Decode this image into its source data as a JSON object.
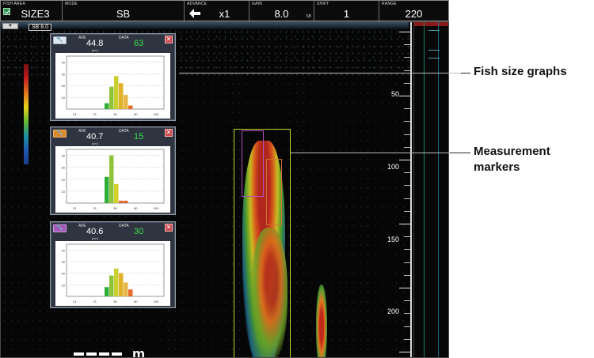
{
  "toolbar": {
    "fish_area": {
      "caption": "FISH AREA",
      "value": "SIZE3",
      "checked": true
    },
    "mode": {
      "caption": "MODE",
      "value": "SB"
    },
    "advance": {
      "caption": "ADVANCE",
      "value": "x1",
      "icon": "arrow-left-icon"
    },
    "gain": {
      "caption": "GAIN",
      "value": "8.0",
      "unit": "SB"
    },
    "shift": {
      "caption": "SHIFT",
      "value": "1"
    },
    "range": {
      "caption": "RANGE",
      "value": "220"
    }
  },
  "echo": {
    "dropdown_icon": "triangle-down-icon",
    "sb_box": "SB 8.0",
    "depth_labels": [
      "50",
      "100",
      "150",
      "200"
    ],
    "scale_unit": "m"
  },
  "panels": [
    {
      "tool_icon": "wrench-icon",
      "ave_caption": "AVE",
      "data_caption": "DATA",
      "ave": "44.8",
      "unit": "[cm]",
      "data": "63",
      "chart_data": {
        "type": "bar",
        "x_ticks": [
          "13",
          "21",
          "36",
          "60",
          "100"
        ],
        "y_ticks": [
          "40",
          "30",
          "20",
          "10"
        ],
        "ylim": [
          0,
          45
        ],
        "values": [
          5,
          19,
          28,
          22,
          12,
          3
        ],
        "colors": [
          "#2fae3a",
          "#8fc43a",
          "#c9cf2c",
          "#e2b12a",
          "#e9b74a",
          "#e86b2a"
        ]
      }
    },
    {
      "tool_icon": "wrench-icon",
      "ave_caption": "AVE",
      "data_caption": "DATA",
      "ave": "40.7",
      "unit": "[cm]",
      "data": "15",
      "chart_data": {
        "type": "bar",
        "x_ticks": [
          "13",
          "21",
          "36",
          "60",
          "100"
        ],
        "y_ticks": [
          "40",
          "30",
          "20",
          "10"
        ],
        "ylim": [
          0,
          45
        ],
        "values": [
          22,
          40,
          16,
          2,
          2
        ],
        "colors": [
          "#2fae3a",
          "#8fc43a",
          "#d6d12a",
          "#e0642a",
          "#e0642a"
        ]
      }
    },
    {
      "tool_icon": "wrench-icon",
      "ave_caption": "AVE",
      "data_caption": "DATA",
      "ave": "40.6",
      "unit": "[cm]",
      "data": "30",
      "chart_data": {
        "type": "bar",
        "x_ticks": [
          "13",
          "21",
          "36",
          "60",
          "100"
        ],
        "y_ticks": [
          "40",
          "30",
          "20",
          "10"
        ],
        "ylim": [
          0,
          45
        ],
        "values": [
          8,
          18,
          24,
          20,
          12,
          6
        ],
        "colors": [
          "#2fae3a",
          "#8fc43a",
          "#c9cf2c",
          "#e2b12a",
          "#e9b74a",
          "#e86b2a"
        ]
      }
    }
  ],
  "annotations": {
    "fish_size": "Fish size graphs",
    "measurement_1": "Measurement",
    "measurement_2": "markers"
  }
}
